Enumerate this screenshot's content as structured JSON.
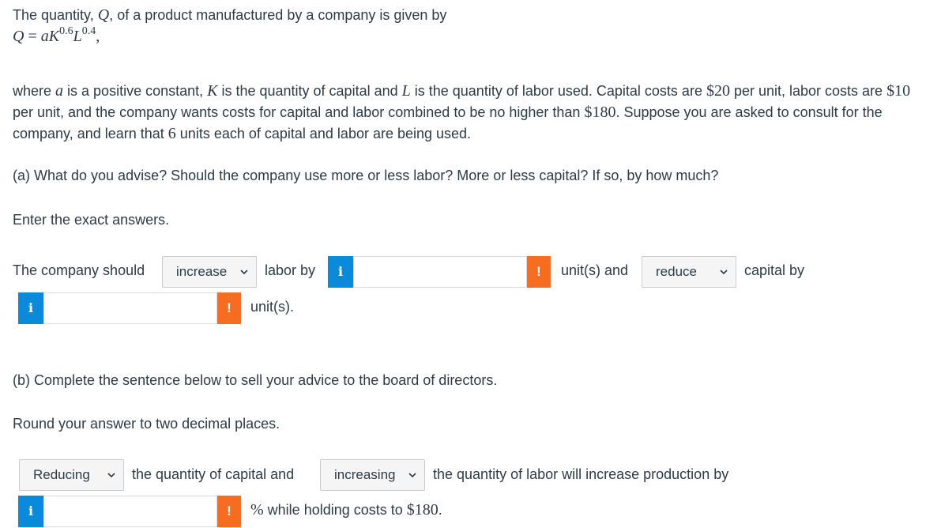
{
  "intro": {
    "line1_text": "The quantity, ",
    "line1_var": "Q",
    "line1_rest": ", of a product manufactured by a company is given by",
    "formula_lhs": "Q",
    "formula_eq": " = ",
    "formula_a": "a",
    "formula_k": "K",
    "formula_k_exp": "0.6",
    "formula_l": "L",
    "formula_l_exp": "0.4",
    "formula_end": ","
  },
  "problem": {
    "p1": "where ",
    "var_a": "a",
    "p2": " is a positive constant, ",
    "var_k": "K",
    "p3": " is the quantity of capital and ",
    "var_l": "L",
    "p4": " is the quantity of labor used. Capital costs are ",
    "cost_capital": "$20",
    "p5": " per unit, labor costs are ",
    "cost_labor": "$10",
    "p6": " per unit, and the company wants costs for capital and labor combined to be no higher than ",
    "cost_max": "$180",
    "p7": ". Suppose you are asked to consult for the company, and learn that ",
    "units": "6",
    "p8": " units each of capital and labor are being used."
  },
  "part_a": {
    "question": "(a) What do you advise? Should the company use more or less labor? More or less capital? If so, by how much?",
    "instruction": "Enter the exact answers.",
    "s1": "The company should",
    "select1_value": "increase",
    "s2": "labor by",
    "s3": "unit(s) and",
    "select2_value": "reduce",
    "s4": "capital by",
    "s5": "unit(s)."
  },
  "part_b": {
    "question": "(b) Complete the sentence below to sell your advice to the board of directors.",
    "instruction": "Round your answer to two decimal places.",
    "select1_value": "Reducing",
    "s1": "the quantity of capital and",
    "select2_value": "increasing",
    "s2": "the quantity of labor will increase production by",
    "s3_pct": "%",
    "s3_text": " while holding costs to ",
    "s3_cost": "$180",
    "s3_end": "."
  },
  "icons": {
    "info_glyph": "i",
    "warn_glyph": "!"
  },
  "colors": {
    "info": "#0a8ad9",
    "warn": "#f66d21",
    "text": "#2d3b45"
  }
}
